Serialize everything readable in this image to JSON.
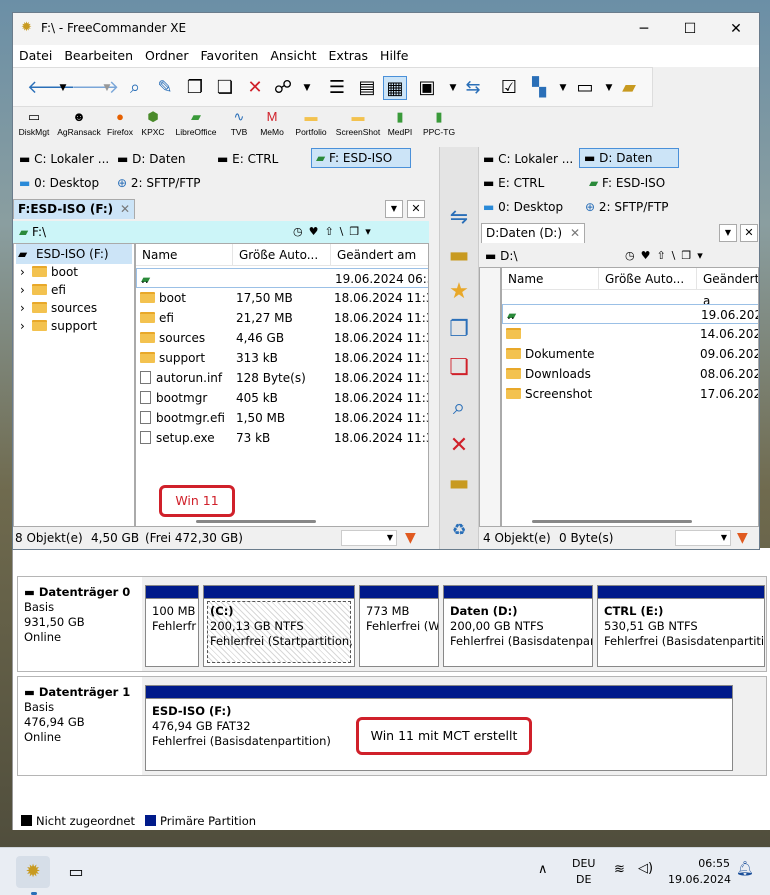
{
  "window": {
    "title": "F:\\ - FreeCommander XE"
  },
  "menu": [
    "Datei",
    "Bearbeiten",
    "Ordner",
    "Favoriten",
    "Ansicht",
    "Extras",
    "Hilfe"
  ],
  "tools": [
    {
      "label": "DiskMgt",
      "icon": "disk-icon"
    },
    {
      "label": "AgRansack",
      "icon": "agent-icon"
    },
    {
      "label": "Firefox",
      "icon": "firefox-icon"
    },
    {
      "label": "KPXC",
      "icon": "keepass-icon"
    },
    {
      "label": "LibreOffice",
      "icon": "libreoffice-icon"
    },
    {
      "label": "TVB",
      "icon": "tvb-icon"
    },
    {
      "label": "MeMo",
      "icon": "memo-icon"
    },
    {
      "label": "Portfolio",
      "icon": "folder-icon"
    },
    {
      "label": "ScreenShot",
      "icon": "folder-icon"
    },
    {
      "label": "MedPI",
      "icon": "doc-icon"
    },
    {
      "label": "PPC-TG",
      "icon": "doc-icon"
    }
  ],
  "left": {
    "drives": [
      "C: Lokaler ...",
      "D: Daten",
      "E: CTRL",
      "F: ESD-ISO",
      "0: Desktop",
      "2: SFTP/FTP"
    ],
    "tab": "F:ESD-ISO (F:)",
    "path": "F:\\",
    "tree": {
      "root": "ESD-ISO (F:)",
      "children": [
        "boot",
        "efi",
        "sources",
        "support"
      ]
    },
    "columns": [
      "Name",
      "Größe Auto...",
      "Geändert am"
    ],
    "files": [
      {
        "name": "..",
        "size": "",
        "date": "19.06.2024 06:5",
        "type": "up"
      },
      {
        "name": "boot",
        "size": "17,50 MB",
        "date": "18.06.2024 11:3",
        "type": "folder"
      },
      {
        "name": "efi",
        "size": "21,27 MB",
        "date": "18.06.2024 11:3",
        "type": "folder"
      },
      {
        "name": "sources",
        "size": "4,46 GB",
        "date": "18.06.2024 11:3",
        "type": "folder"
      },
      {
        "name": "support",
        "size": "313 kB",
        "date": "18.06.2024 11:3",
        "type": "folder"
      },
      {
        "name": "autorun.inf",
        "size": "128 Byte(s)",
        "date": "18.06.2024 11:3",
        "type": "file"
      },
      {
        "name": "bootmgr",
        "size": "405 kB",
        "date": "18.06.2024 11:3",
        "type": "file"
      },
      {
        "name": "bootmgr.efi",
        "size": "1,50 MB",
        "date": "18.06.2024 11:3",
        "type": "file"
      },
      {
        "name": "setup.exe",
        "size": "73 kB",
        "date": "18.06.2024 11:3",
        "type": "file"
      }
    ],
    "note": "Win 11",
    "status": {
      "count": "8 Objekt(e)",
      "size": "4,50 GB",
      "free": "(Frei 472,30 GB)"
    }
  },
  "right": {
    "drives": [
      "C: Lokaler ...",
      "D: Daten",
      "E: CTRL",
      "F: ESD-ISO",
      "0: Desktop",
      "2: SFTP/FTP"
    ],
    "tab": "D:Daten (D:)",
    "path": "D:\\",
    "columns": [
      "Name",
      "Größe Auto...",
      "Geändert a"
    ],
    "files": [
      {
        "name": "..",
        "date": "19.06.2024",
        "type": "up"
      },
      {
        "name": "",
        "date": "14.06.2024",
        "type": "folder"
      },
      {
        "name": "Dokumente",
        "date": "09.06.2024",
        "type": "folder"
      },
      {
        "name": "Downloads",
        "date": "08.06.2024",
        "type": "folder"
      },
      {
        "name": "Screenshot",
        "date": "17.06.2024",
        "type": "folder"
      }
    ],
    "status": {
      "count": "4 Objekt(e)",
      "size": "0 Byte(s)"
    }
  },
  "disks": [
    {
      "name": "Datenträger 0",
      "type": "Basis",
      "size": "931,50 GB",
      "state": "Online",
      "parts": [
        {
          "l1": "",
          "l2": "100 MB",
          "l3": "Fehlerfr"
        },
        {
          "l1": "(C:)",
          "l2": "200,13 GB NTFS",
          "l3": "Fehlerfrei (Startpartition, A"
        },
        {
          "l1": "",
          "l2": "773 MB",
          "l3": "Fehlerfrei (W"
        },
        {
          "l1": "Daten  (D:)",
          "l2": "200,00 GB NTFS",
          "l3": "Fehlerfrei (Basisdatenpartit"
        },
        {
          "l1": "CTRL  (E:)",
          "l2": "530,51 GB NTFS",
          "l3": "Fehlerfrei (Basisdatenpartitior"
        }
      ]
    },
    {
      "name": "Datenträger 1",
      "type": "Basis",
      "size": "476,94 GB",
      "state": "Online",
      "parts": [
        {
          "l1": "ESD-ISO  (F:)",
          "l2": "476,94 GB FAT32",
          "l3": "Fehlerfrei (Basisdatenpartition)"
        }
      ]
    }
  ],
  "disk_note": "Win 11 mit MCT erstellt",
  "legend": {
    "unallocated": "Nicht zugeordnet",
    "primary": "Primäre Partition"
  },
  "taskbar": {
    "lang1": "DEU",
    "lang2": "DE",
    "time": "06:55",
    "date": "19.06.2024"
  },
  "colors": {
    "primary_partition": "#001a8a",
    "selected": "#cce4f7",
    "note": "#d0202a"
  }
}
